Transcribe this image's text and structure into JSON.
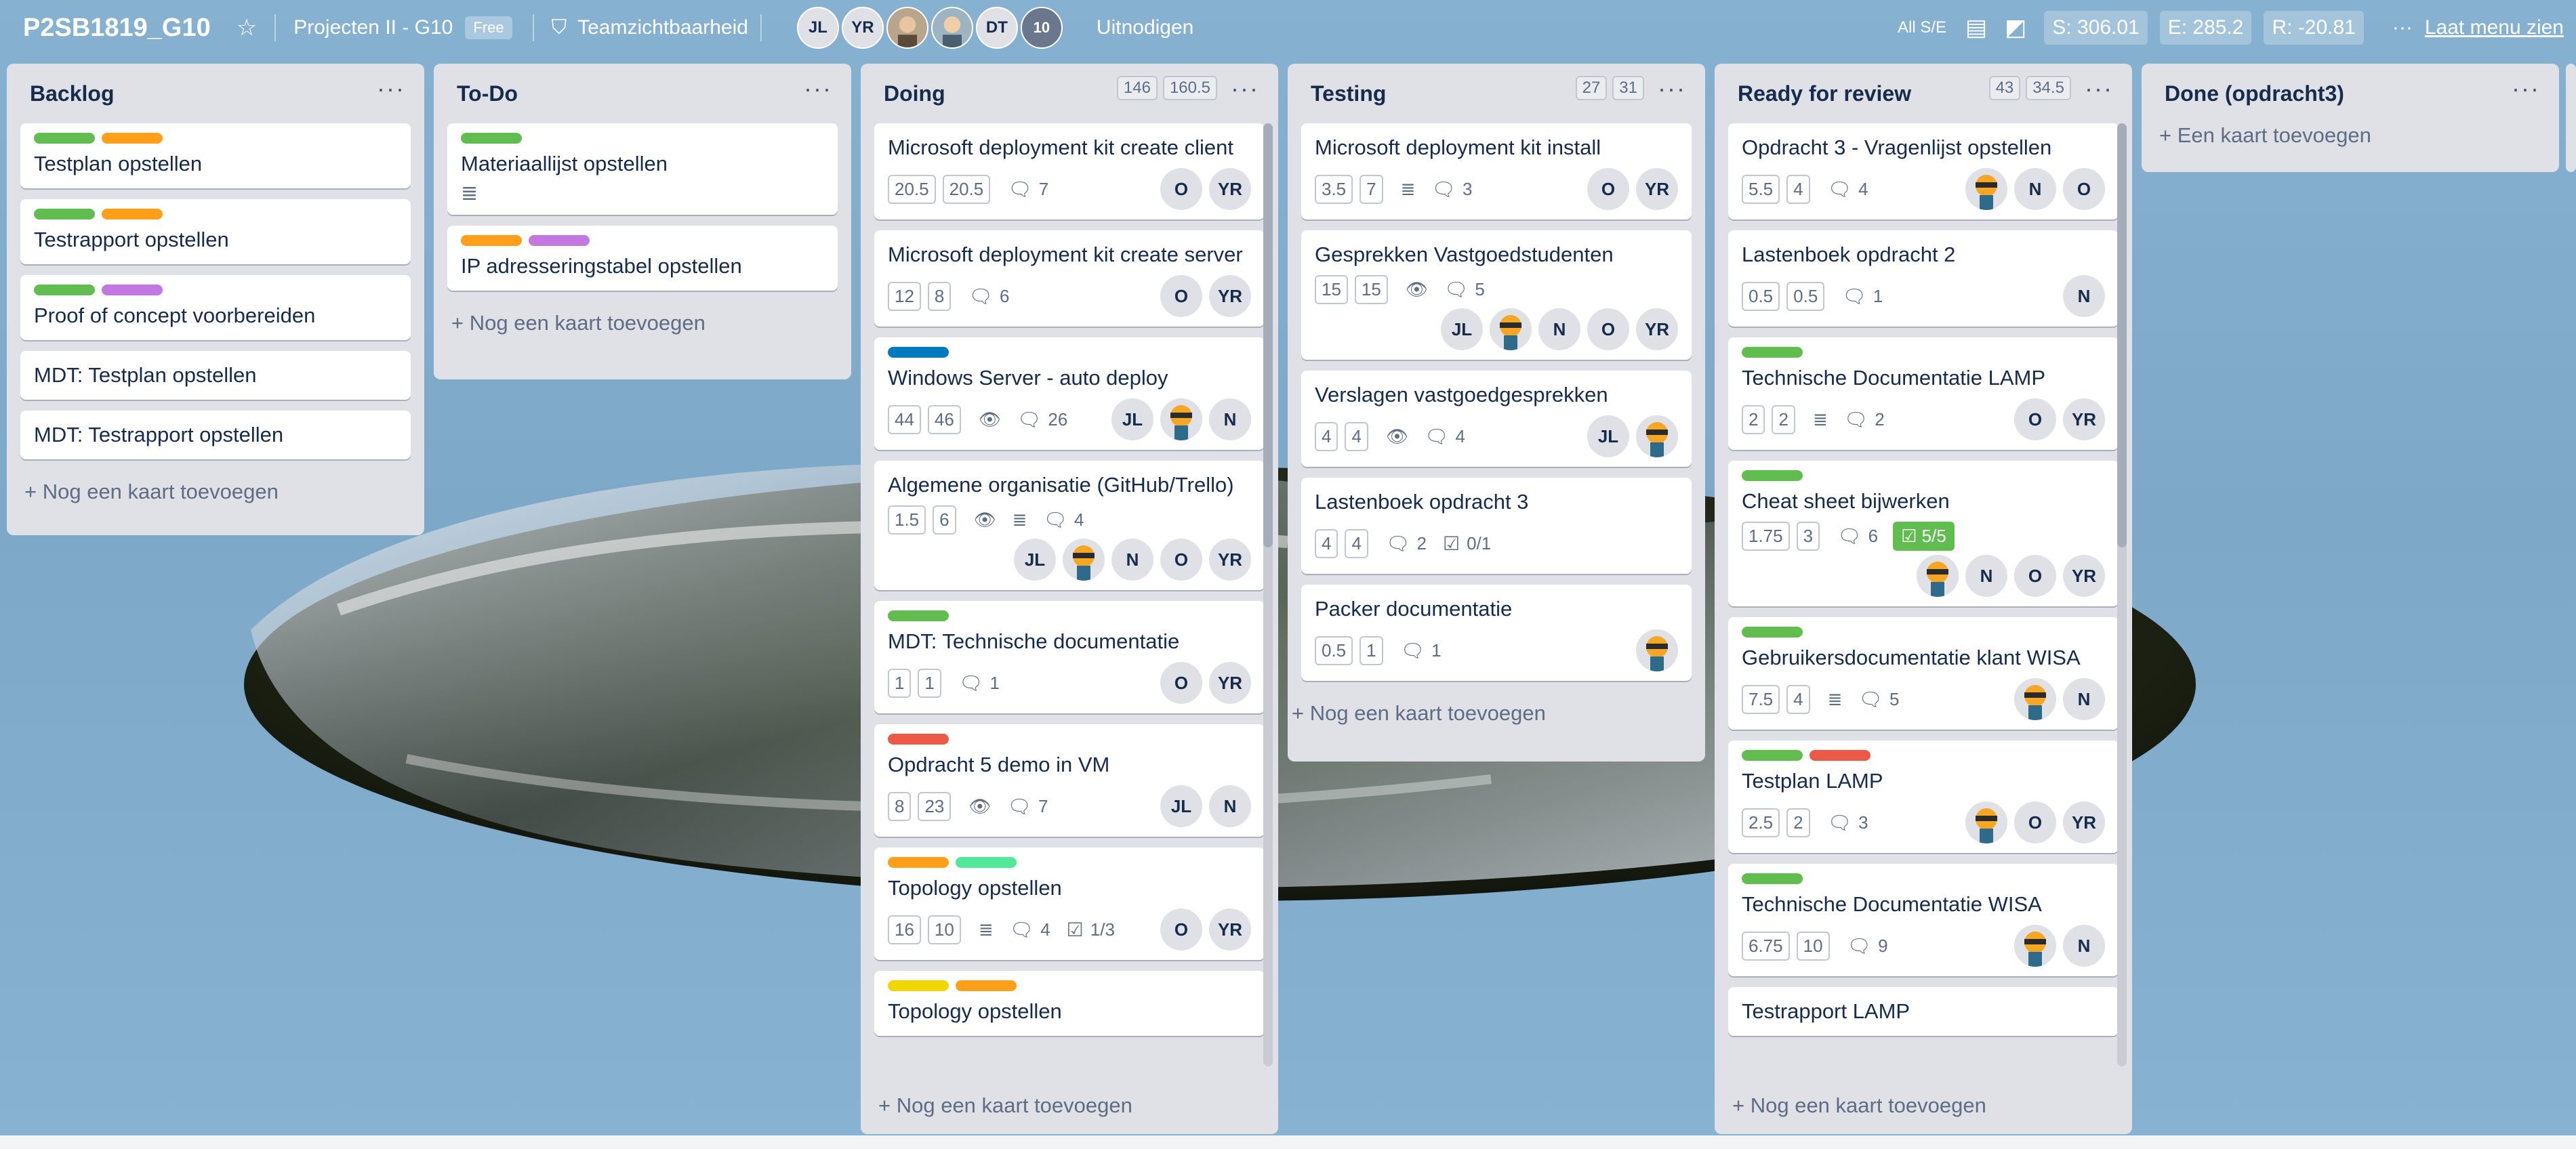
{
  "header": {
    "board_title": "P2SB1819_G10",
    "team": "Projecten II - G10",
    "plan": "Free",
    "visibility": "Teamzichtbaarheid",
    "members": [
      "JL",
      "YR",
      "DT"
    ],
    "member_count": "10",
    "invite": "Uitnodigen",
    "filter": "All S/E",
    "stats": {
      "s": "S: 306.01",
      "e": "E: 285.2",
      "r": "R: -20.81"
    },
    "menu_dots": "···",
    "menu": "Laat menu zien"
  },
  "colors": {
    "green": "#61bd4f",
    "orange": "#ff9f1a",
    "purple": "#c377e0",
    "red": "#eb5a46",
    "blue": "#0079bf",
    "lime": "#51e898",
    "yellow": "#f2d600"
  },
  "lists": {
    "backlog": {
      "title": "Backlog",
      "add": "+ Nog een kaart toevoegen",
      "cards": [
        {
          "title": "Testplan opstellen",
          "labels": [
            "green",
            "orange"
          ]
        },
        {
          "title": "Testrapport opstellen",
          "labels": [
            "green",
            "orange"
          ]
        },
        {
          "title": "Proof of concept voorbereiden",
          "labels": [
            "green",
            "purple"
          ]
        },
        {
          "title": "MDT: Testplan opstellen"
        },
        {
          "title": "MDT: Testrapport opstellen"
        }
      ]
    },
    "todo": {
      "title": "To-Do",
      "add": "+ Nog een kaart toevoegen",
      "cards": [
        {
          "title": "Materiaallijst opstellen",
          "labels": [
            "green"
          ],
          "icon": "description-icon"
        },
        {
          "title": "IP adresseringstabel opstellen",
          "labels": [
            "orange",
            "purple"
          ]
        }
      ]
    },
    "doing": {
      "title": "Doing",
      "counts": [
        "146",
        "160.5"
      ],
      "add": "+ Nog een kaart toevoegen",
      "cards": [
        {
          "title": "Microsoft deployment kit create client",
          "pills": [
            "20.5",
            "20.5"
          ],
          "comments": "7",
          "avatars": [
            "O",
            "YR"
          ]
        },
        {
          "title": "Microsoft deployment kit create server",
          "pills": [
            "12",
            "8"
          ],
          "comments": "6",
          "avatars": [
            "O",
            "YR"
          ]
        },
        {
          "title": "Windows Server - auto deploy",
          "labels": [
            "blue"
          ],
          "pills": [
            "44",
            "46"
          ],
          "comments": "26",
          "avatars": [
            "JL",
            "ninja",
            "N"
          ]
        },
        {
          "title": "Algemene organisatie (GitHub/Trello)",
          "pills": [
            "1.5",
            "6"
          ],
          "comments": "4",
          "avatars": [
            "JL",
            "ninja",
            "N",
            "O",
            "YR"
          ]
        },
        {
          "title": "MDT: Technische documentatie",
          "labels": [
            "green"
          ],
          "pills": [
            "1",
            "1"
          ],
          "comments": "1",
          "avatars": [
            "O",
            "YR"
          ]
        },
        {
          "title": "Opdracht 5 demo in VM",
          "labels": [
            "red"
          ],
          "pills": [
            "8",
            "23"
          ],
          "comments": "7",
          "avatars": [
            "JL",
            "N"
          ]
        },
        {
          "title": "Topology opstellen",
          "labels": [
            "orange",
            "lime"
          ],
          "pills": [
            "16",
            "10"
          ],
          "comments": "4",
          "checklist": "1/3",
          "avatars": [
            "O",
            "YR"
          ]
        },
        {
          "title": "Topology opstellen",
          "labels": [
            "yellow",
            "orange"
          ]
        }
      ]
    },
    "testing": {
      "title": "Testing",
      "counts": [
        "27",
        "31"
      ],
      "add": "+ Nog een kaart toevoegen",
      "cards": [
        {
          "title": "Microsoft deployment kit install",
          "pills": [
            "3.5",
            "7"
          ],
          "comments": "3",
          "avatars": [
            "O",
            "YR"
          ]
        },
        {
          "title": "Gesprekken Vastgoedstudenten",
          "pills": [
            "15",
            "15"
          ],
          "comments": "5",
          "avatars": [
            "JL",
            "ninja",
            "N",
            "O",
            "YR"
          ]
        },
        {
          "title": "Verslagen vastgoedgesprekken",
          "pills": [
            "4",
            "4"
          ],
          "comments": "4",
          "avatars": [
            "JL",
            "ninja"
          ]
        },
        {
          "title": "Lastenboek opdracht 3",
          "pills": [
            "4",
            "4"
          ],
          "comments": "2",
          "checklist": "0/1"
        },
        {
          "title": "Packer documentatie",
          "pills": [
            "0.5",
            "1"
          ],
          "comments": "1",
          "avatars": [
            "ninja"
          ]
        }
      ]
    },
    "review": {
      "title": "Ready for review",
      "counts": [
        "43",
        "34.5"
      ],
      "add": "+ Nog een kaart toevoegen",
      "cards": [
        {
          "title": "Opdracht 3 - Vragenlijst opstellen",
          "pills": [
            "5.5",
            "4"
          ],
          "comments": "4",
          "avatars": [
            "ninja",
            "N",
            "O"
          ]
        },
        {
          "title": "Lastenboek opdracht 2",
          "pills": [
            "0.5",
            "0.5"
          ],
          "comments": "1",
          "avatars": [
            "N"
          ]
        },
        {
          "title": "Technische Documentatie LAMP",
          "labels": [
            "green"
          ],
          "pills": [
            "2",
            "2"
          ],
          "comments": "2",
          "avatars": [
            "O",
            "YR"
          ]
        },
        {
          "title": "Cheat sheet bijwerken",
          "labels": [
            "green"
          ],
          "pills": [
            "1.75",
            "3"
          ],
          "comments": "6",
          "checklist": "5/5",
          "avatars": [
            "ninja",
            "N",
            "O",
            "YR"
          ]
        },
        {
          "title": "Gebruikersdocumentatie klant WISA",
          "labels": [
            "green"
          ],
          "pills": [
            "7.5",
            "4"
          ],
          "comments": "5",
          "avatars": [
            "ninja",
            "N"
          ]
        },
        {
          "title": "Testplan LAMP",
          "labels": [
            "green",
            "red"
          ],
          "pills": [
            "2.5",
            "2"
          ],
          "comments": "3",
          "avatars": [
            "ninja",
            "O",
            "YR"
          ]
        },
        {
          "title": "Technische Documentatie WISA",
          "labels": [
            "green"
          ],
          "pills": [
            "6.75",
            "10"
          ],
          "comments": "9",
          "avatars": [
            "ninja",
            "N"
          ]
        },
        {
          "title": "Testrapport LAMP"
        }
      ]
    },
    "done": {
      "title": "Done (opdracht3)",
      "add": "+ Een kaart toevoegen"
    }
  }
}
